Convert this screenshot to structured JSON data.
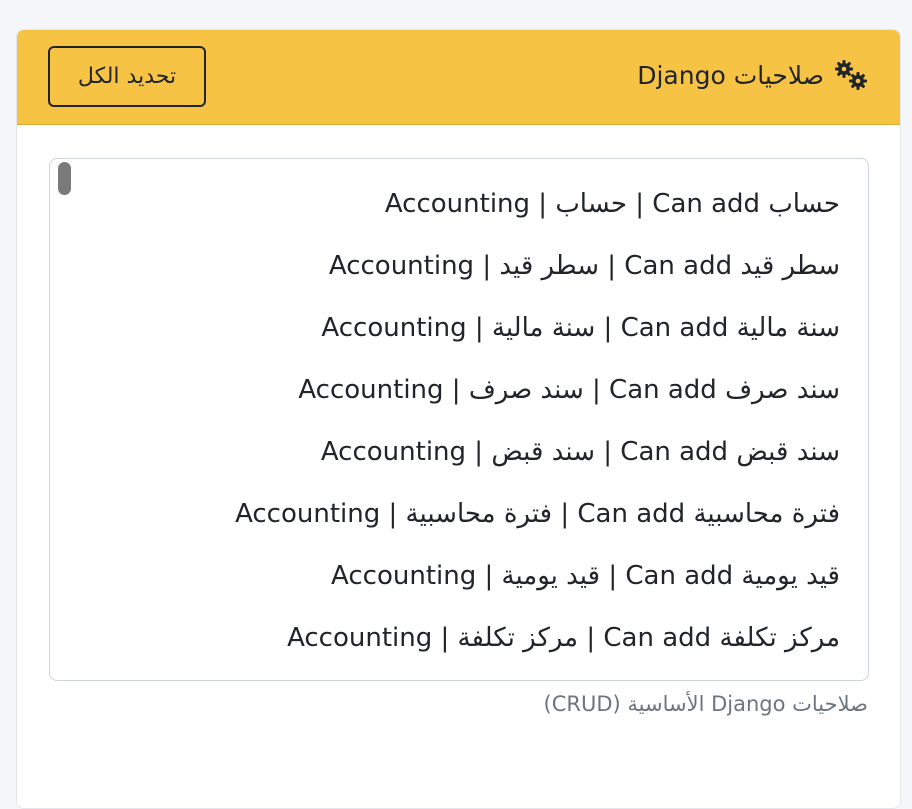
{
  "card": {
    "title": "صلاحيات Django",
    "title_icon": "gears-icon",
    "select_all_label": "تحديد الكل"
  },
  "permissions": [
    "Accounting | حساب | Can add حساب",
    "Accounting | سطر قيد | Can add سطر قيد",
    "Accounting | سنة مالية | Can add سنة مالية",
    "Accounting | سند صرف | Can add سند صرف",
    "Accounting | سند قبض | Can add سند قبض",
    "Accounting | فترة محاسبية | Can add فترة محاسبية",
    "Accounting | قيد يومية | Can add قيد يومية",
    "Accounting | مركز تكلفة | Can add مركز تكلفة"
  ],
  "help_text": "صلاحيات Django الأساسية (CRUD)",
  "colors": {
    "header_bg": "#f6c344",
    "text": "#212529",
    "muted": "#6c757d"
  }
}
